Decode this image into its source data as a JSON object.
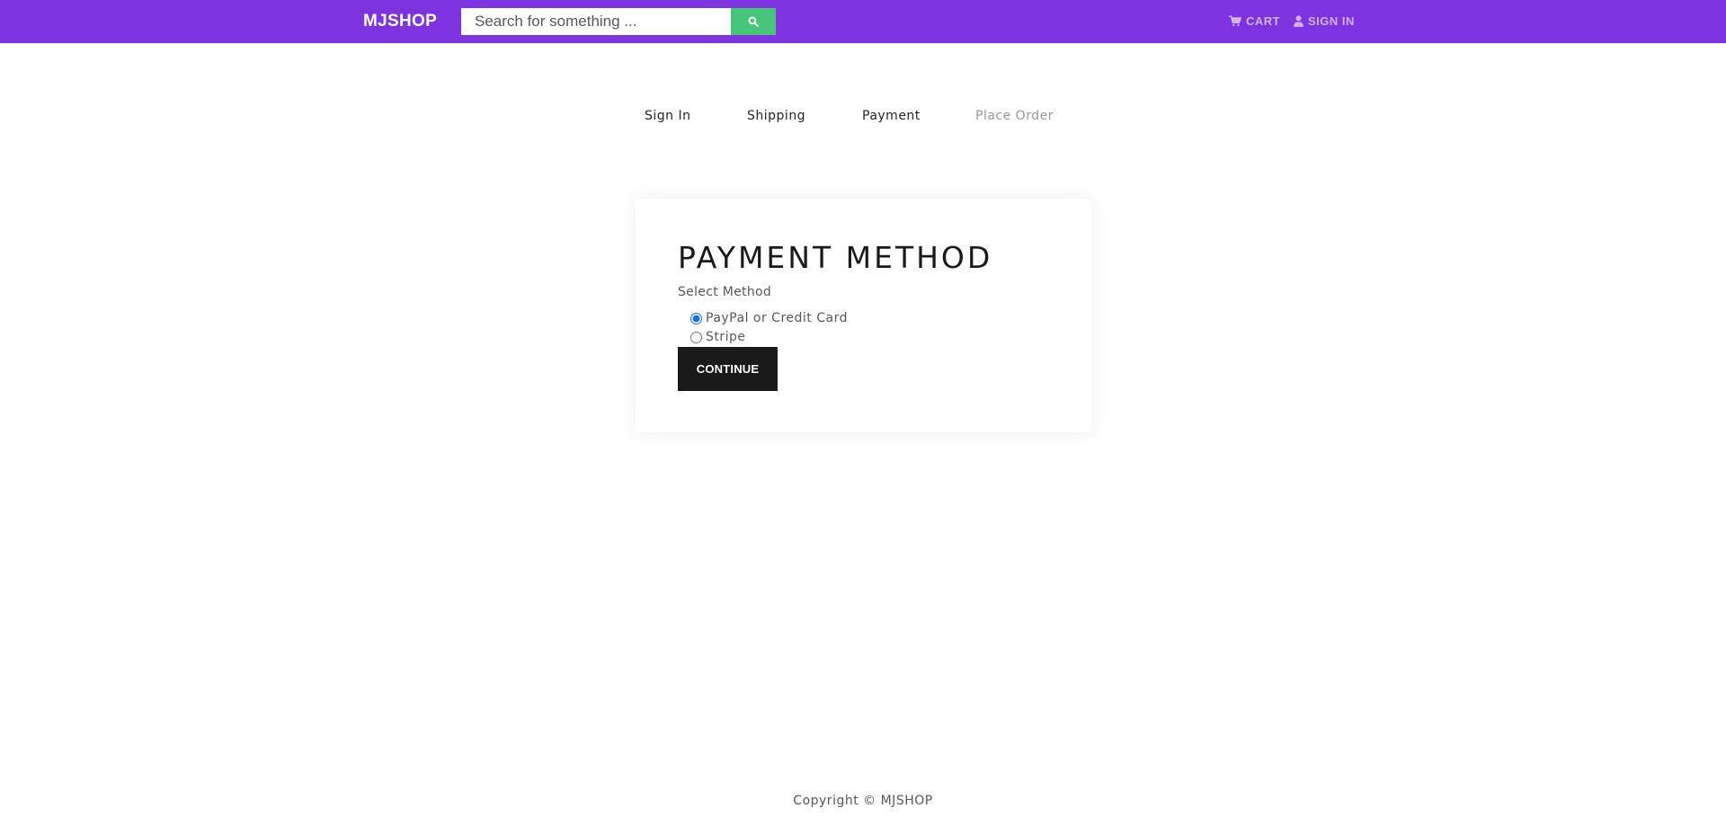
{
  "header": {
    "brand": "MJSHOP",
    "search": {
      "placeholder": "Search for something ...",
      "value": ""
    },
    "search_button_icon": "search-icon",
    "links": {
      "cart_label": "CART",
      "cart_icon": "cart-icon",
      "signin_label": "SIGN IN",
      "signin_icon": "user-icon"
    },
    "colors": {
      "navbar_bg": "#7e33e0",
      "search_button_bg": "#45c67b"
    }
  },
  "checkout_steps": {
    "items": [
      {
        "label": "Sign In",
        "enabled": true
      },
      {
        "label": "Shipping",
        "enabled": true
      },
      {
        "label": "Payment",
        "enabled": true
      },
      {
        "label": "Place Order",
        "enabled": false
      }
    ]
  },
  "payment_form": {
    "title": "PAYMENT METHOD",
    "select_label": "Select Method",
    "options": [
      {
        "label": "PayPal or Credit Card",
        "checked": true
      },
      {
        "label": "Stripe",
        "checked": false
      }
    ],
    "continue_label": "CONTINUE"
  },
  "footer": {
    "copyright": "Copyright © MJSHOP"
  }
}
